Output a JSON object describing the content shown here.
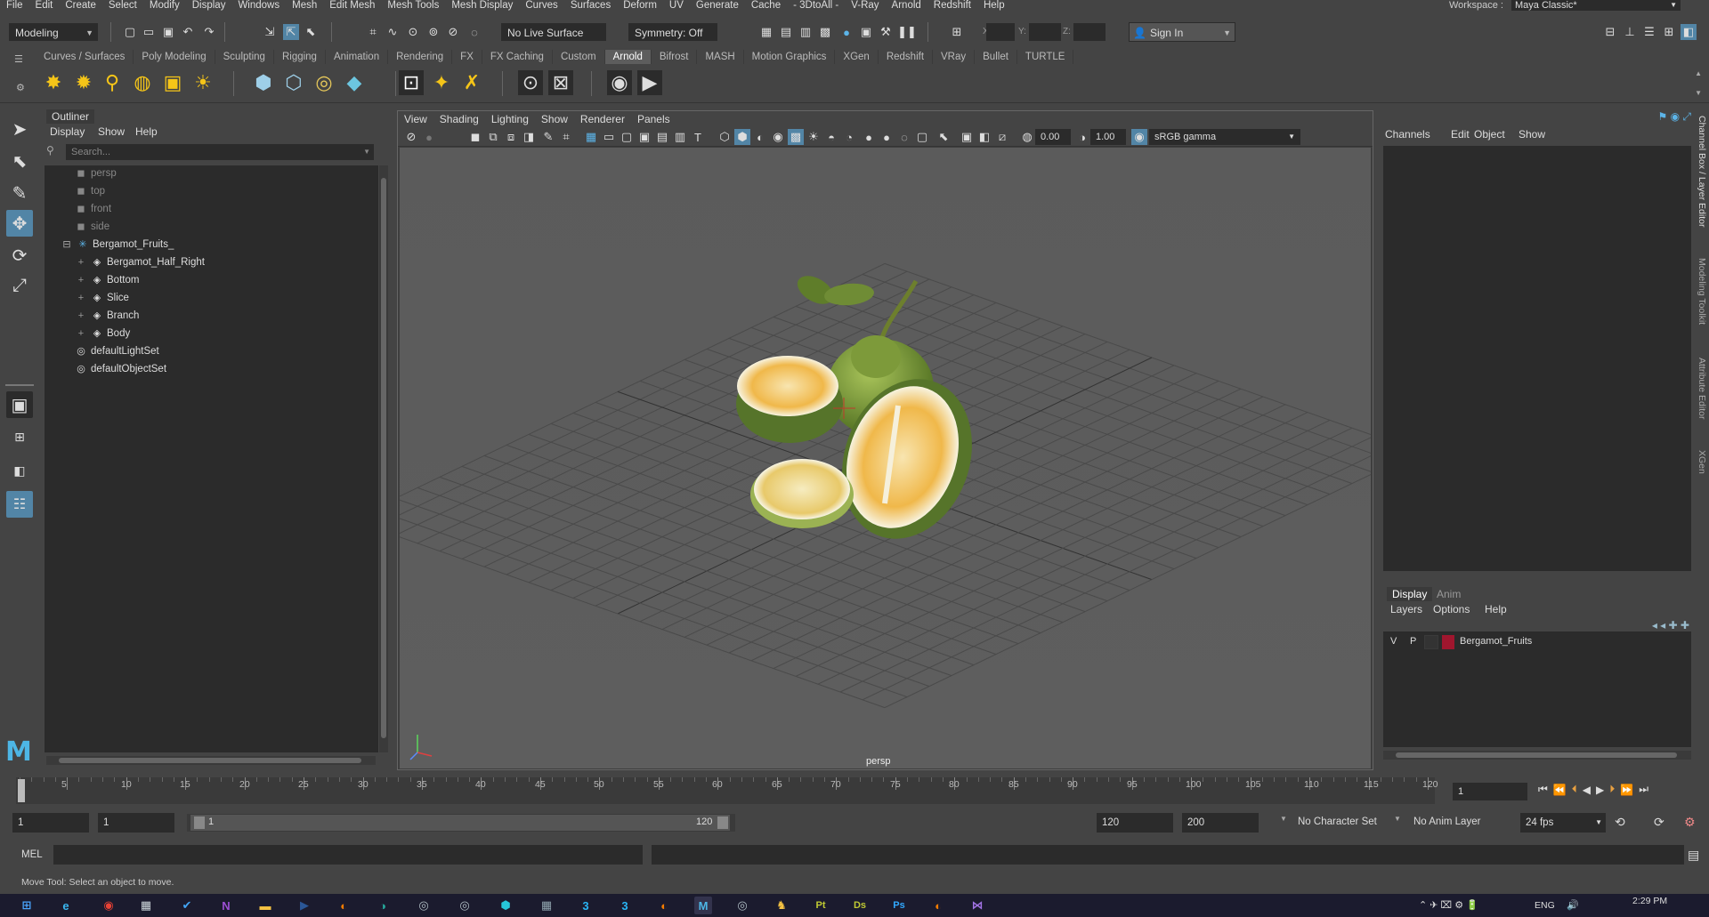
{
  "menubar": {
    "items": [
      "File",
      "Edit",
      "Create",
      "Select",
      "Modify",
      "Display",
      "Windows",
      "Mesh",
      "Edit Mesh",
      "Mesh Tools",
      "Mesh Display",
      "Curves",
      "Surfaces",
      "Deform",
      "UV",
      "Generate",
      "Cache",
      "- 3DtoAll -",
      "V-Ray",
      "Arnold",
      "Redshift",
      "Help"
    ],
    "workspace_label": "Workspace :",
    "workspace_value": "Maya Classic*"
  },
  "statusline": {
    "mode": "Modeling",
    "live_surface": "No Live Surface",
    "symmetry": "Symmetry: Off",
    "x_label": "X:",
    "y_label": "Y:",
    "z_label": "Z:",
    "sign_in": "Sign In"
  },
  "shelf": {
    "tabs": [
      "Curves / Surfaces",
      "Poly Modeling",
      "Sculpting",
      "Rigging",
      "Animation",
      "Rendering",
      "FX",
      "FX Caching",
      "Custom",
      "Arnold",
      "Bifrost",
      "MASH",
      "Motion Graphics",
      "XGen",
      "Redshift",
      "VRay",
      "Bullet",
      "TURTLE"
    ],
    "active_tab": "Arnold"
  },
  "outliner": {
    "title": "Outliner",
    "menu": [
      "Display",
      "Show",
      "Help"
    ],
    "search_placeholder": "Search...",
    "cameras": [
      "persp",
      "top",
      "front",
      "side"
    ],
    "group": "Bergamot_Fruits_",
    "children": [
      "Bergamot_Half_Right",
      "Bottom",
      "Slice",
      "Branch",
      "Body"
    ],
    "sets": [
      "defaultLightSet",
      "defaultObjectSet"
    ]
  },
  "viewport": {
    "menu": [
      "View",
      "Shading",
      "Lighting",
      "Show",
      "Renderer",
      "Panels"
    ],
    "exposure": "0.00",
    "gamma": "1.00",
    "color_space": "sRGB gamma",
    "camera_label": "persp"
  },
  "channelbox": {
    "menu": [
      "Channels",
      "Edit",
      "Object",
      "Show"
    ]
  },
  "layereditor": {
    "tabs": [
      "Display",
      "Anim"
    ],
    "active_tab": "Display",
    "menu": [
      "Layers",
      "Options",
      "Help"
    ],
    "layer": {
      "v": "V",
      "p": "P",
      "name": "Bergamot_Fruits",
      "color": "#a0162e"
    }
  },
  "side_tabs": [
    "Channel Box / Layer Editor",
    "Modeling Toolkit",
    "Attribute Editor",
    "XGen"
  ],
  "timeslider": {
    "ticks": [
      1,
      5,
      10,
      15,
      20,
      25,
      30,
      35,
      40,
      45,
      50,
      55,
      60,
      65,
      70,
      75,
      80,
      85,
      90,
      95,
      100,
      105,
      110,
      115,
      120
    ],
    "current_frame": "1"
  },
  "rangeslider": {
    "start": "1",
    "anim_start": "1",
    "range_start_label": "1",
    "range_end_label": "120",
    "anim_end": "120",
    "end": "200",
    "character_set": "No Character Set",
    "anim_layer": "No Anim Layer",
    "fps": "24 fps"
  },
  "cmdline": {
    "label": "MEL"
  },
  "helpline": {
    "text": "Move Tool: Select an object to move."
  },
  "taskbar": {
    "lang": "ENG",
    "time": "2:29 PM"
  }
}
